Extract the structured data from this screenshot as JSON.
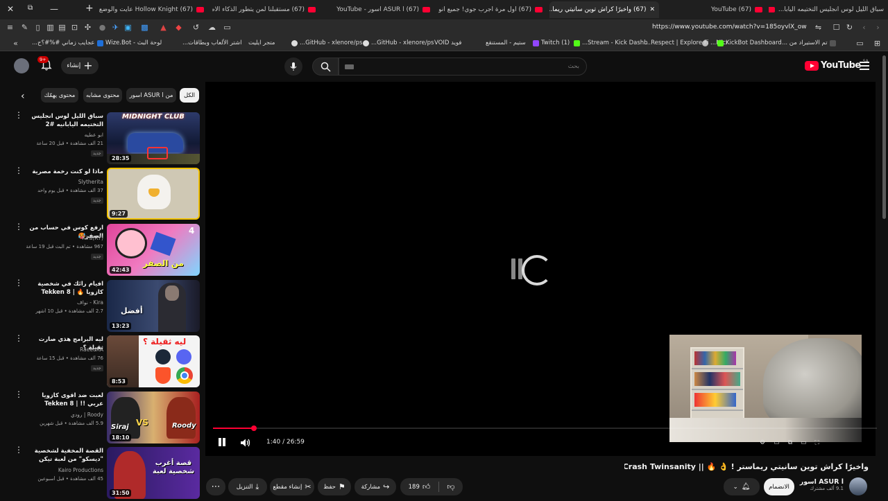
{
  "browser": {
    "tabs": [
      {
        "title": "سباق الليل لوس انجليس التختيمه اليابا..."
      },
      {
        "title": "(67) YouTube"
      },
      {
        "title": "(67) واخيرًا كراش توين سانيتي ريما..."
      },
      {
        "title": "(67) اول مرة اجرب جوي! جميع انواع الاغ..."
      },
      {
        "title": "(67) ASUR l اسور - YouTube"
      },
      {
        "title": "(67) مستقبلنا لمن يتطور الذكاء الاصطن..."
      },
      {
        "title": "(67) Hollow Knight عايت والوضع ضياع ..."
      }
    ],
    "url": "https://www.youtube.com/watch?v=185oyvlX_ow",
    "bookmarks": [
      "تم الاستيراد من ...",
      "Micr...",
      "KickBot Dashboard",
      "Respect | Explore Fi...",
      "Stream - Kick Dashb...",
      "Twitch (1)",
      "ستيم - المستنقع",
      "فويد VOID",
      "GitHub - xlenore/ps...",
      "GitHub - xlenore/ps...",
      "متجر ايليت",
      "اشتر الألعاب وبطاقات...",
      "لوحة البث - Wize.Bot",
      "عجايب زماني #%#؟ح..."
    ]
  },
  "header": {
    "logo_text": "YouTube",
    "logo_region": "SA",
    "search_placeholder": "بحث",
    "search_text": "",
    "create_label": "إنشاء",
    "notif_count": "9+"
  },
  "chips": [
    {
      "label": "الكل",
      "selected": true
    },
    {
      "label": "من ASUR l اسور"
    },
    {
      "label": "محتوى مشابه"
    },
    {
      "label": "محتوى يهمّك"
    }
  ],
  "videos": [
    {
      "title": "سباق الليل لوس انجليس التختيمه اليابانيه #2",
      "channel": "ابو عطيه",
      "meta": "21 ألف مشاهدة • قبل 20 ساعة",
      "badge": "جديد",
      "duration": "28:35"
    },
    {
      "title": "ماذا لو كنت رخمة مصرية",
      "channel": "Slytherita",
      "meta": "37 ألف مشاهدة • قبل يوم واحد",
      "badge": "جديد",
      "duration": "9:27"
    },
    {
      "title": "ارفع كوس في حساب من الصفر🥵",
      "channel": "Kira(R7)",
      "meta": "967 مشاهدة • تم البث قبل 19 ساعة",
      "badge": "جديد",
      "duration": "42:43"
    },
    {
      "title": "افيام رائك في شخصية كازويا 🔥 | Tekken 8",
      "channel": "Kira - نواف",
      "meta": "2.7 ألف مشاهدة • قبل 10 أشهر",
      "badge": "",
      "duration": "13:23"
    },
    {
      "title": "ليه البرامج هذي صارت ثقيلة ؟",
      "channel": "RaeedXA",
      "meta": "76 ألف مشاهدة • قبل 15 ساعة",
      "badge": "جديد",
      "duration": "8:53"
    },
    {
      "title": "لعبت ضد اقوى كازويا عربي !! | Tekken 8",
      "channel": "Roody | رودي",
      "meta": "5.9 ألف مشاهدة • قبل شهرين",
      "badge": "",
      "duration": "18:10"
    },
    {
      "title": "القصة المخفية لشخصية \"ديسكو\" من لعبة تيكن",
      "channel": "Kairo Productions",
      "meta": "45 ألف مشاهدة • قبل أسبوعين",
      "badge": "",
      "duration": "31:50"
    }
  ],
  "thumb_texts": {
    "t1": "MIDNIGHT CLUB",
    "t3": "من الصفر",
    "t3n": "4",
    "t4": "أفضل",
    "t5": "ليه ثقيلة ؟",
    "t6a": "Siraj",
    "t6b": "Roody",
    "t6c": "VS",
    "t7": "قصة أغرب شخصية لعبة"
  },
  "player": {
    "time": "1:40 / 26:59",
    "progress": 0.062
  },
  "video": {
    "title": "واخيرًا كراش توين سانيتي ريماستر ! 👌 🔥 || Crash Twinsanity",
    "channel": "ASUR l اسور",
    "subs": "9.1 ألف مشترك",
    "join_label": "الانضمام",
    "like_count": "189",
    "share_label": "مشاركة",
    "save_label": "حفظ",
    "clip_label": "إنشاء مقطع",
    "download_label": "التنزيل"
  },
  "colors": {
    "accent": "#ff0033",
    "bg": "#0f0f0f",
    "chip": "#272727"
  }
}
